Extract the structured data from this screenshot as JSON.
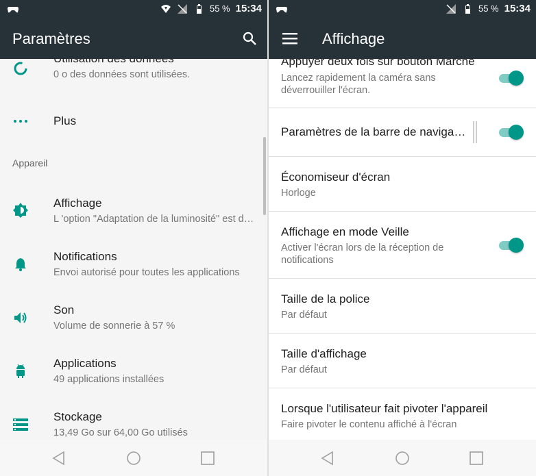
{
  "colors": {
    "accent": "#009688",
    "appbar": "#263238",
    "status_text": "#ffffff"
  },
  "status": {
    "battery": "55 %",
    "time": "15:34"
  },
  "left": {
    "title": "Paramètres",
    "rows": [
      {
        "icon": "data-usage-icon",
        "title": "Utilisation des données",
        "subtitle": "0  o des données sont utilisées."
      },
      {
        "icon": "more-dots-icon",
        "title": "Plus",
        "subtitle": ""
      },
      {
        "icon": "brightness-icon",
        "title": "Affichage",
        "subtitle": "L 'option \"Adaptation de la luminosité\" est désactivée"
      },
      {
        "icon": "bell-icon",
        "title": "Notifications",
        "subtitle": "Envoi autorisé pour toutes les applications"
      },
      {
        "icon": "volume-icon",
        "title": "Son",
        "subtitle": "Volume de sonnerie à 57 %"
      },
      {
        "icon": "android-icon",
        "title": "Applications",
        "subtitle": "49 applications installées"
      },
      {
        "icon": "storage-icon",
        "title": "Stockage",
        "subtitle": "13,49   Go sur 64,00   Go utilisés"
      }
    ],
    "section": "Appareil"
  },
  "right": {
    "title": "Affichage",
    "rows": [
      {
        "title": "Appuyer deux fois sur bouton Marche",
        "subtitle": "Lancez rapidement la caméra sans déverrouiller l'écran.",
        "toggle": true
      },
      {
        "title": "Paramètres de la barre de navigation",
        "subtitle": "",
        "toggle": true
      },
      {
        "title": "Économiseur d'écran",
        "subtitle": "Horloge",
        "toggle": false
      },
      {
        "title": "Affichage en mode Veille",
        "subtitle": "Activer l'écran lors de la réception de notifications",
        "toggle": true
      },
      {
        "title": "Taille de la police",
        "subtitle": "Par défaut",
        "toggle": false
      },
      {
        "title": "Taille d'affichage",
        "subtitle": "Par défaut",
        "toggle": false
      },
      {
        "title": "Lorsque l'utilisateur fait pivoter l'appareil",
        "subtitle": "Faire pivoter le contenu affiché à l'écran",
        "toggle": false
      }
    ]
  }
}
